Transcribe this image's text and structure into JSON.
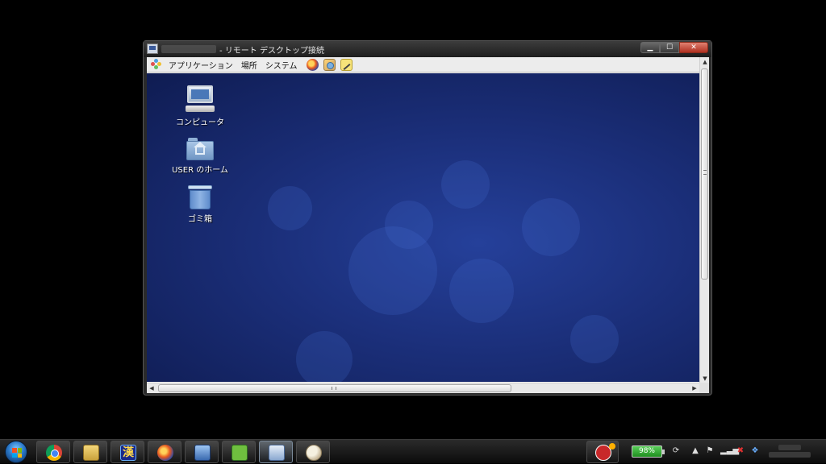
{
  "window": {
    "title": "- リモート デスクトップ接続",
    "buttons": {
      "minimize": "▁",
      "maximize": "☐",
      "close": "✕"
    }
  },
  "panel": {
    "menus": [
      "アプリケーション",
      "場所",
      "システム"
    ],
    "launchers": [
      "firefox-icon",
      "evolution-icon",
      "text-editor-icon"
    ]
  },
  "desktop_icons": [
    {
      "label": "コンピュータ",
      "icon": "computer-icon"
    },
    {
      "label": "USER のホーム",
      "icon": "home-folder-icon"
    },
    {
      "label": "ゴミ箱",
      "icon": "trash-icon"
    }
  ],
  "taskbar": {
    "apps": [
      "chrome-icon",
      "explorer-icon",
      "kanji-app-icon",
      "firefox-icon",
      "network-icon",
      "evernote-icon",
      "remote-desktop-icon",
      "paint-icon"
    ],
    "active_app": "remote-desktop-icon",
    "kanji_glyph": "漢"
  },
  "tray": {
    "battery": "98%",
    "icons": [
      "sync-icon",
      "show-hidden-arrow-icon",
      "flag-icon",
      "signal-icon",
      "volume-icon",
      "dropbox-icon"
    ],
    "arrow_glyph": "▲"
  },
  "colors": {
    "desktop_bg": "#1b2f7a",
    "panel_bg": "#ececec",
    "taskbar_bg": "#1a1a1a",
    "battery": "#3fbf3f",
    "close": "#c8382a"
  }
}
